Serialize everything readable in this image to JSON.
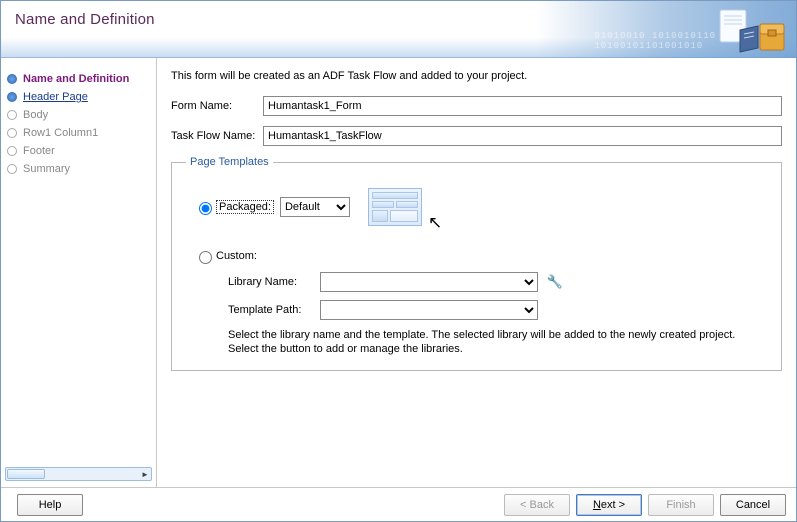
{
  "header": {
    "title": "Name and Definition"
  },
  "nav": {
    "items": [
      {
        "label": "Name and Definition"
      },
      {
        "label": "Header Page"
      },
      {
        "label": "Body"
      },
      {
        "label": "Row1 Column1"
      },
      {
        "label": "Footer"
      },
      {
        "label": "Summary"
      }
    ]
  },
  "content": {
    "intro": "This form will be created as an ADF Task Flow and added to your project.",
    "form_name_label": "Form Name:",
    "form_name_value": "Humantask1_Form",
    "task_flow_label": "Task Flow Name:",
    "task_flow_value": "Humantask1_TaskFlow"
  },
  "templates": {
    "legend": "Page Templates",
    "packaged_label": "Packaged:",
    "packaged_value": "Default",
    "custom_label": "Custom:",
    "library_label": "Library Name:",
    "library_value": "",
    "template_label": "Template Path:",
    "template_value": "",
    "hint": "Select the library name and the template.  The selected library will be added to the newly created project.  Select the button to add or manage the libraries."
  },
  "footer": {
    "help": "Help",
    "back": "< Back",
    "next": "Next >",
    "finish": "Finish",
    "cancel": "Cancel"
  }
}
